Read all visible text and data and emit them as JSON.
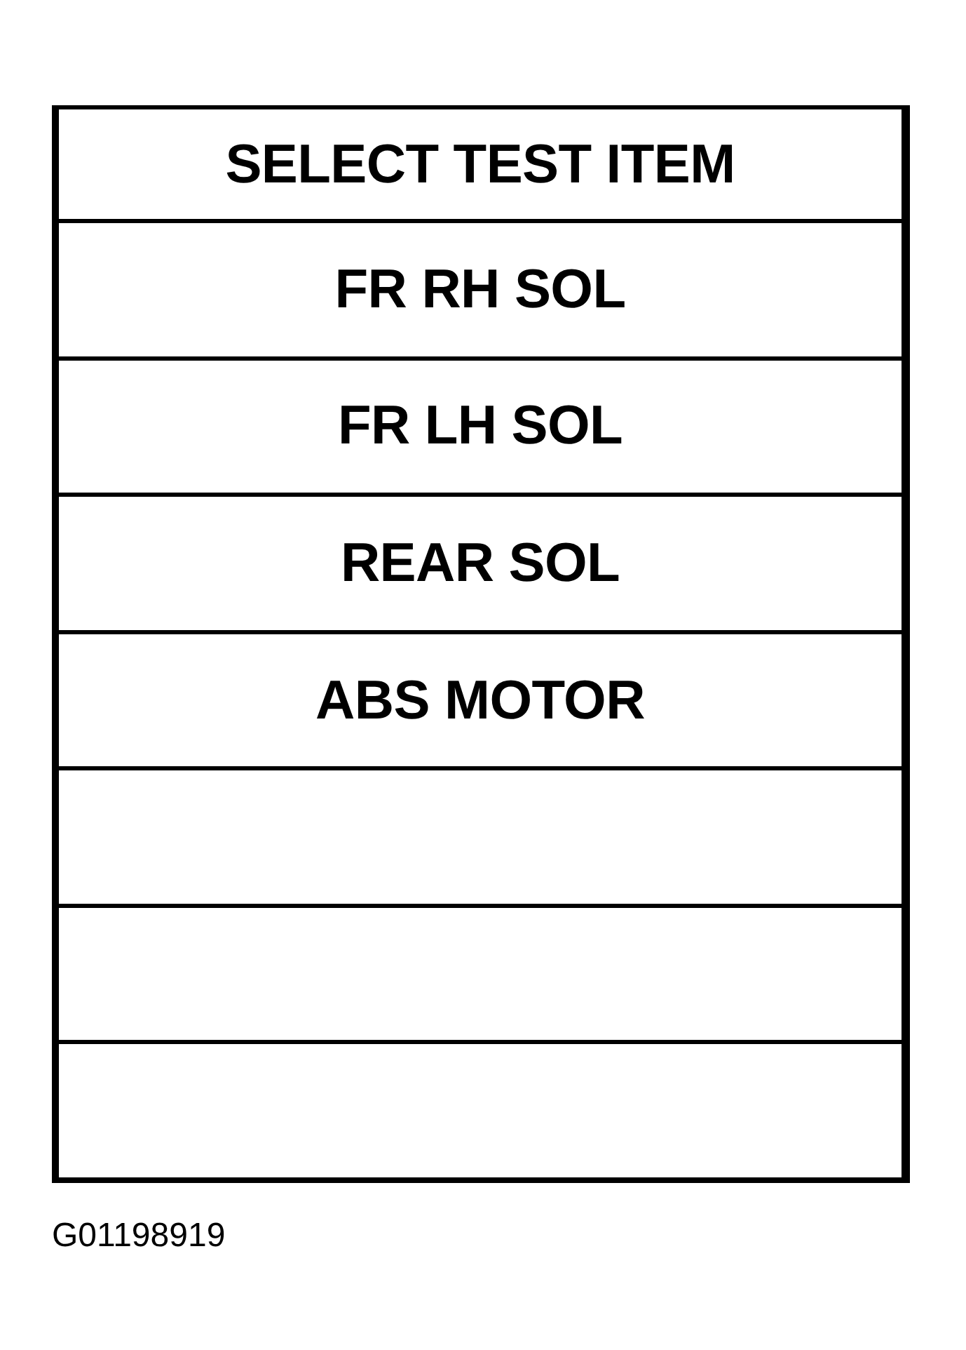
{
  "screen": {
    "title": "SELECT TEST ITEM",
    "rows": [
      {
        "kind": "item",
        "label": "FR RH SOL"
      },
      {
        "kind": "item",
        "label": "FR LH SOL"
      },
      {
        "kind": "item",
        "label": "REAR SOL"
      },
      {
        "kind": "item",
        "label": "ABS MOTOR"
      },
      {
        "kind": "blank"
      },
      {
        "kind": "blank"
      },
      {
        "kind": "blank"
      }
    ]
  },
  "figure_code": "G01198919"
}
